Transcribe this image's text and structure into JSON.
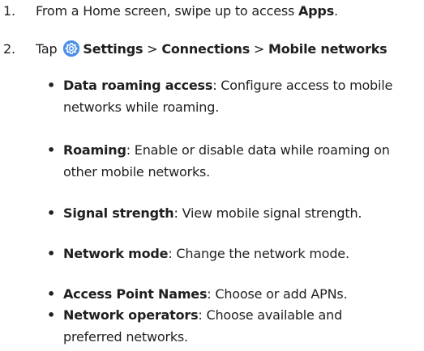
{
  "steps": [
    {
      "number": "1.",
      "text_before": "From a Home screen, swipe up to access ",
      "bold": "Apps",
      "text_after": "."
    },
    {
      "number": "2.",
      "tap": "Tap",
      "icon": "settings-gear-icon",
      "path": [
        {
          "label": "Settings",
          "separator": ">"
        },
        {
          "label": "Connections",
          "separator": ">"
        },
        {
          "label": "Mobile networks",
          "separator": ""
        }
      ]
    }
  ],
  "options": [
    {
      "term": "Data roaming access",
      "description": ": Configure access to mobile networks while roaming."
    },
    {
      "term": "Roaming",
      "description": ": Enable or disable data while roaming on other mobile networks."
    },
    {
      "term": "Signal strength",
      "description": ": View mobile signal strength."
    },
    {
      "term": "Network mode",
      "description": ": Change the network mode."
    },
    {
      "term": "Access Point Names",
      "description": ": Choose or add APNs."
    },
    {
      "term": "Network operators",
      "description": ": Choose available and preferred networks."
    }
  ],
  "colors": {
    "icon_bg": "#4a8fe8",
    "text": "#1f1f1f"
  }
}
